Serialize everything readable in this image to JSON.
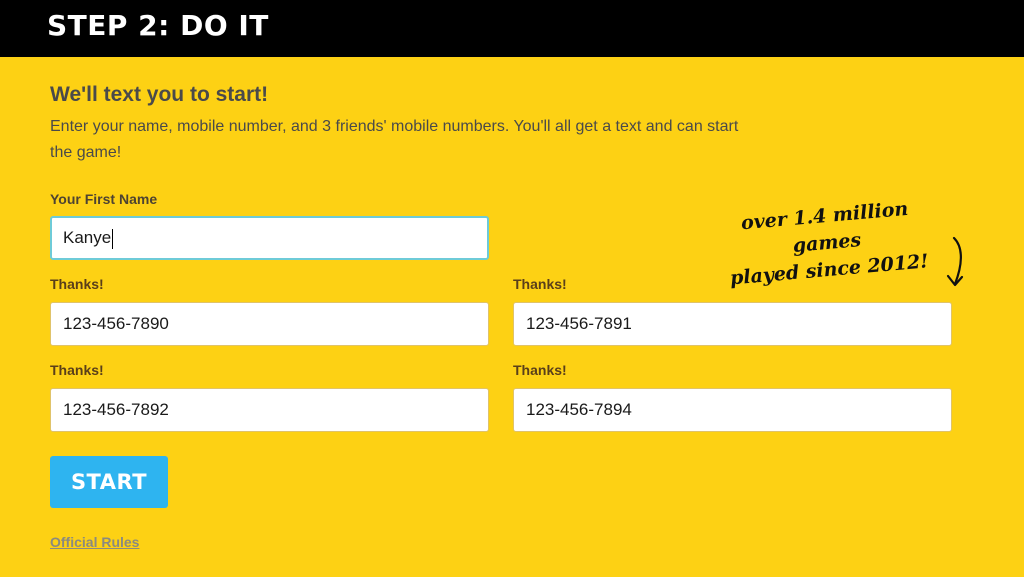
{
  "header": {
    "title": "STEP 2: DO IT"
  },
  "intro": {
    "heading": "We'll text you to start!",
    "description": "Enter your name, mobile number, and 3 friends' mobile numbers. You'll all get a text and can start the game!"
  },
  "form": {
    "name_label": "Your First Name",
    "name_value": "Kanye",
    "phones": [
      {
        "label": "Thanks!",
        "value": "123-456-7890"
      },
      {
        "label": "Thanks!",
        "value": "123-456-7891"
      },
      {
        "label": "Thanks!",
        "value": "123-456-7892"
      },
      {
        "label": "Thanks!",
        "value": "123-456-7894"
      }
    ],
    "start_label": "START",
    "rules_label": "Official Rules"
  },
  "annotation": {
    "line1": "over 1.4 million games",
    "line2": "played since 2012!"
  },
  "colors": {
    "background": "#fdd114",
    "header": "#000000",
    "button": "#2eb4f0",
    "focus_border": "#6ecbd8"
  },
  "icons": {
    "annotation_arrow": "curved-arrow-down-icon"
  }
}
